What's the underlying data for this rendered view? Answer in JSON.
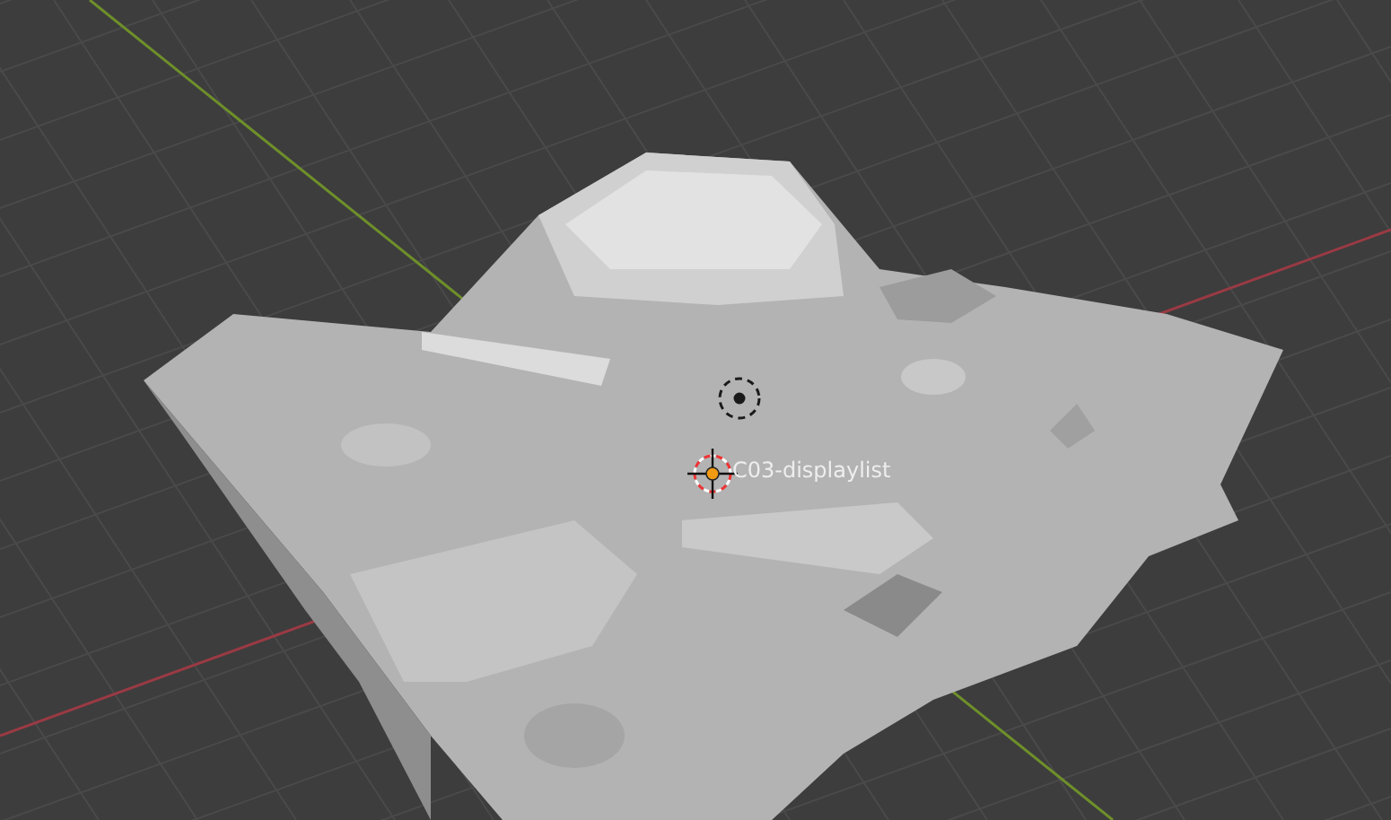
{
  "viewport": {
    "object_label": "C03-displaylist"
  }
}
